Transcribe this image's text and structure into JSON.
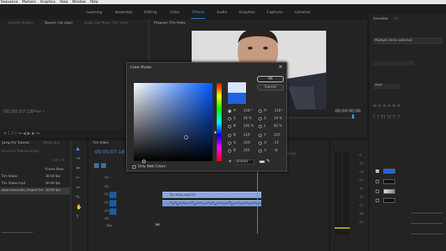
{
  "menu": [
    "Sequence",
    "Markers",
    "Graphics",
    "View",
    "Window",
    "Help"
  ],
  "workspaces": {
    "tabs": [
      "Learning",
      "Assembly",
      "Editing",
      "Color",
      "Effects",
      "Audio",
      "Graphics",
      "Captions",
      "Libraries"
    ],
    "active": "Effects"
  },
  "source_panel": {
    "tabs": [
      "Lumetri Scopes",
      "Source: (no clips)",
      "Audio Clip Mixer: Tim Video"
    ],
    "fit": "Page 1",
    "timecode_left": "00:00:07:18"
  },
  "program": {
    "tab": "Program: Tim Video",
    "timecode_right": "00:00:00:00"
  },
  "right_panel": {
    "tab": "Essential",
    "tab_suffix": "Gr",
    "summary": "Multiple items selected",
    "font": "Bold",
    "swatch_colors": [
      "#1f63e0",
      "#d0d0d0",
      "#111111",
      "#111111"
    ]
  },
  "project": {
    "title": "Jump Pro Tutorial",
    "tab": "Media Bro",
    "file": "Jump Pro Tutorial.prproj",
    "count": "1 of 3 it...",
    "column": "Frame Rate",
    "items": [
      {
        "name": "Tim Video",
        "fps": "30.00 fps"
      },
      {
        "name": "Tim Video.mp4",
        "fps": "30.00 fps"
      },
      {
        "name": "BDD-subscribe_Project file",
        "fps": "30.00 fps"
      }
    ]
  },
  "timeline": {
    "tab": "Tim Video",
    "timecode": "00:00:07:18",
    "ruler_label": "10:00",
    "tracks": [
      "V3",
      "V2",
      "V1",
      "A1",
      "A2",
      "A3",
      "Mix"
    ],
    "clip_v1": "Tim Video.mp4 [V]",
    "clip_a1": "",
    "meter_ticks": [
      "-6",
      "-12",
      "-18",
      "-24",
      "-30",
      "-36",
      "-42",
      "-48",
      "-54"
    ]
  },
  "color_picker": {
    "title": "Color Picker",
    "ok": "OK",
    "cancel": "Cancel",
    "only_web_colors": "Only Web Colors",
    "new_color": "#d7e5ff",
    "old_color": "#1f63e0",
    "hsb": [
      {
        "label": "H",
        "value": "218 °"
      },
      {
        "label": "S",
        "value": "16 %"
      },
      {
        "label": "B",
        "value": "100 %"
      }
    ],
    "rgb": [
      {
        "label": "R",
        "value": "215"
      },
      {
        "label": "G",
        "value": "229"
      },
      {
        "label": "B",
        "value": "255"
      }
    ],
    "hsl": [
      {
        "label": "H",
        "value": "218 °"
      },
      {
        "label": "S",
        "value": "14 %"
      },
      {
        "label": "L",
        "value": "92 %"
      }
    ],
    "yuv": [
      {
        "label": "Y",
        "value": "225"
      },
      {
        "label": "U",
        "value": "13"
      },
      {
        "label": "V",
        "value": "-8"
      }
    ],
    "hex_label": "#",
    "hex": "D7E5FF"
  }
}
